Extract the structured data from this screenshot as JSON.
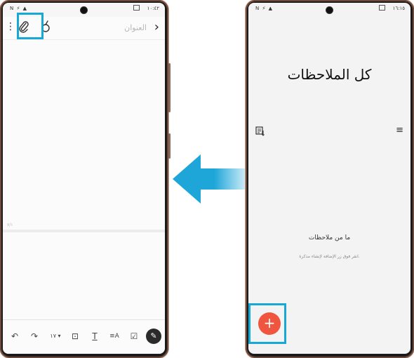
{
  "left_phone": {
    "status": {
      "time": "١٠:٤٢",
      "signal": "N ⚡ ▲"
    },
    "editor": {
      "title_placeholder": "العنوان",
      "back_glyph": "›",
      "kebab_glyph": "⋮",
      "attach_icon": "paperclip-icon",
      "brush_icon": "brush-icon",
      "page_marker": "٧/١"
    },
    "toolbar": {
      "undo": "↶",
      "redo": "↷",
      "font_size": "١٧ ▾",
      "text_box": "⊡",
      "text_style": "T",
      "paragraph": "≡A",
      "checklist": "☑",
      "pen": "✎"
    },
    "highlight_color": "#17a8d6"
  },
  "right_phone": {
    "status": {
      "time": "١٦:١٥",
      "signal": "N ⚡ ▲"
    },
    "heading": "كل الملاحظات",
    "menu_glyph": "≡",
    "sort_icon": "sort-icon",
    "empty_title": "ما من ملاحظات",
    "empty_hint": "انقر فوق زر الإضافة لإنشاء مذكرة.",
    "fab_glyph": "+",
    "fab_color": "#f0553f"
  },
  "arrow_color": "#1ea6d9"
}
